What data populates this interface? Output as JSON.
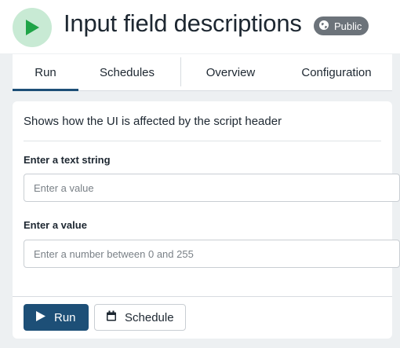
{
  "header": {
    "title": "Input field descriptions",
    "badge": "Public",
    "app_icon": "play-icon",
    "badge_icon": "globe-icon"
  },
  "tabs": [
    {
      "label": "Run",
      "active": true
    },
    {
      "label": "Schedules",
      "active": false
    },
    {
      "label": "Overview",
      "active": false
    },
    {
      "label": "Configuration",
      "active": false
    }
  ],
  "form": {
    "description": "Shows how the UI is affected by the script header",
    "fields": [
      {
        "label": "Enter a text string",
        "placeholder": "Enter a value",
        "value": ""
      },
      {
        "label": "Enter a value",
        "placeholder": "Enter a number between 0 and 255",
        "value": ""
      }
    ]
  },
  "actions": {
    "run_label": "Run",
    "schedule_label": "Schedule",
    "run_icon": "play-icon",
    "schedule_icon": "calendar-icon"
  },
  "colors": {
    "accent": "#1d4f77",
    "icon_green": "#1fa447",
    "icon_bg": "#c8ead4",
    "badge_bg": "#6c737a",
    "page_bg": "#edf0f2"
  }
}
